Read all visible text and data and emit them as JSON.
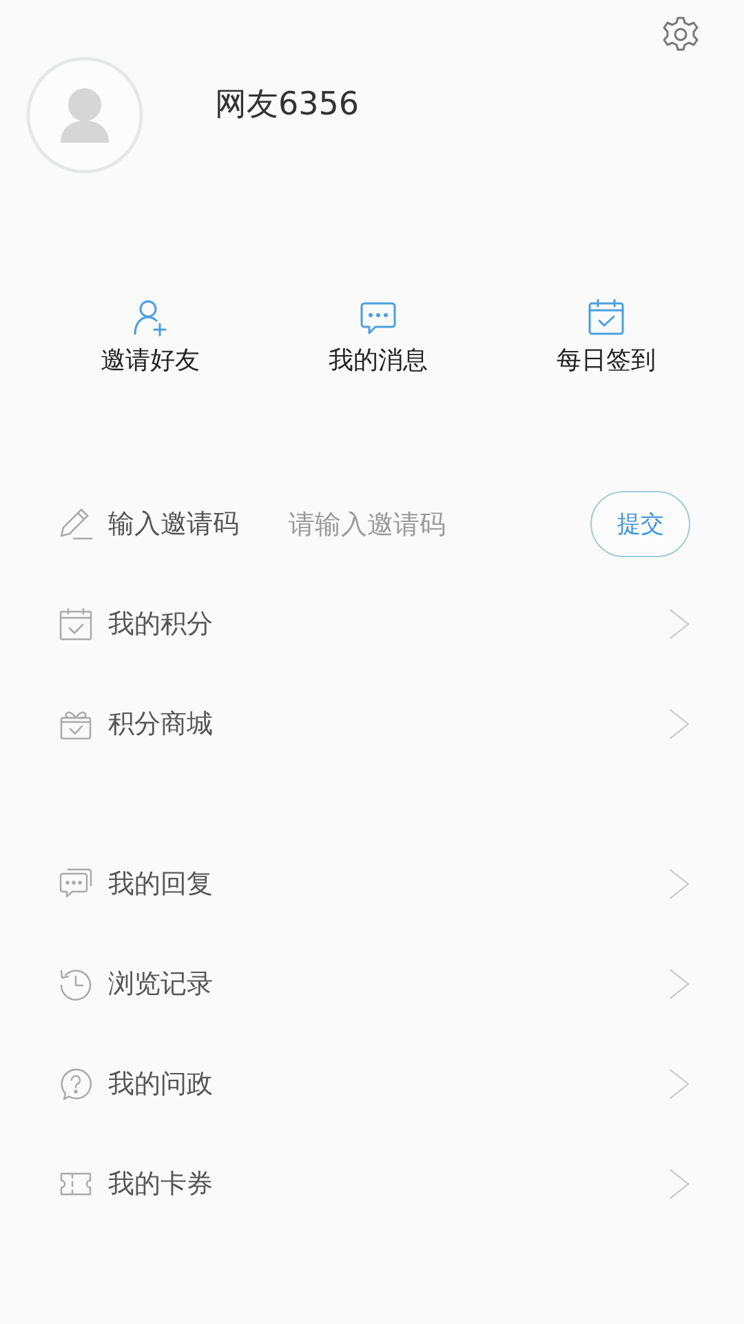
{
  "header": {
    "username": "网友6356"
  },
  "quick_actions": [
    {
      "label": "邀请好友"
    },
    {
      "label": "我的消息"
    },
    {
      "label": "每日签到"
    }
  ],
  "invite": {
    "label": "输入邀请码",
    "placeholder": "请输入邀请码",
    "button": "提交"
  },
  "menu_sections": [
    {
      "items": [
        {
          "label": "我的积分"
        },
        {
          "label": "积分商城"
        }
      ]
    },
    {
      "items": [
        {
          "label": "我的回复"
        },
        {
          "label": "浏览记录"
        },
        {
          "label": "我的问政"
        },
        {
          "label": "我的卡券"
        }
      ]
    }
  ]
}
